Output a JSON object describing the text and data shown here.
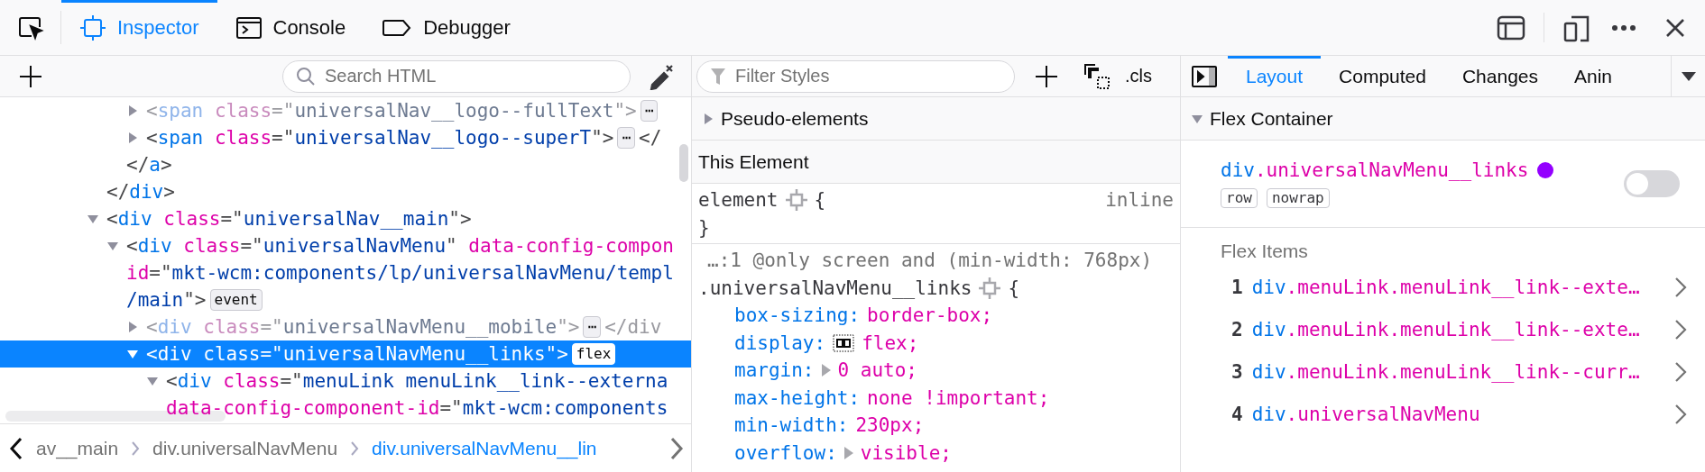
{
  "toolbar": {
    "tabs": [
      {
        "label": "Inspector",
        "kind": "inspector",
        "selected": true
      },
      {
        "label": "Console",
        "kind": "console",
        "selected": false
      },
      {
        "label": "Debugger",
        "kind": "debugger",
        "selected": false
      }
    ]
  },
  "markup": {
    "search_placeholder": "Search HTML",
    "nodes": [
      {
        "children": [
          {
            "children": [
              {
                "lines": [
                  [
                    {
                      "kind": "punct",
                      "text": "<"
                    },
                    {
                      "kind": "tag",
                      "text": "span"
                    },
                    {
                      "kind": "attr",
                      "text": " class"
                    },
                    {
                      "kind": "punct",
                      "text": "=\""
                    },
                    {
                      "kind": "value",
                      "text": "universalNav__logo--fullText"
                    },
                    {
                      "kind": "punct",
                      "text": "\">"
                    },
                    {
                      "kind": "badge",
                      "text": "⋯"
                    }
                  ]
                ],
                "expanded": false,
                "dimmed": true,
                "selected": false
              },
              {
                "lines": [
                  [
                    {
                      "kind": "punct",
                      "text": "<"
                    },
                    {
                      "kind": "tag",
                      "text": "span"
                    },
                    {
                      "kind": "attr",
                      "text": " class"
                    },
                    {
                      "kind": "punct",
                      "text": "=\""
                    },
                    {
                      "kind": "value",
                      "text": "universalNav__logo--superT"
                    },
                    {
                      "kind": "punct",
                      "text": "\">"
                    },
                    {
                      "kind": "badge",
                      "text": "⋯"
                    },
                    {
                      "kind": "punct",
                      "text": "</"
                    }
                  ]
                ],
                "expanded": false,
                "dimmed": false,
                "selected": false
              }
            ],
            "closing": [
              {
                "kind": "punct",
                "text": "</"
              },
              {
                "kind": "tag",
                "text": "a"
              },
              {
                "kind": "punct",
                "text": ">"
              }
            ]
          }
        ],
        "closing": [
          {
            "kind": "punct",
            "text": "</"
          },
          {
            "kind": "tag",
            "text": "div"
          },
          {
            "kind": "punct",
            "text": ">"
          }
        ]
      },
      {
        "lines": [
          [
            {
              "kind": "punct",
              "text": "<"
            },
            {
              "kind": "tag",
              "text": "div"
            },
            {
              "kind": "attr",
              "text": " class"
            },
            {
              "kind": "punct",
              "text": "=\""
            },
            {
              "kind": "value",
              "text": "universalNav__main"
            },
            {
              "kind": "punct",
              "text": "\">"
            }
          ]
        ],
        "expanded": true,
        "dimmed": false,
        "selected": false,
        "children": [
          {
            "lines": [
              [
                {
                  "kind": "punct",
                  "text": "<"
                },
                {
                  "kind": "tag",
                  "text": "div"
                },
                {
                  "kind": "attr",
                  "text": " class"
                },
                {
                  "kind": "punct",
                  "text": "=\""
                },
                {
                  "kind": "value",
                  "text": "universalNavMenu"
                },
                {
                  "kind": "punct",
                  "text": "\""
                },
                {
                  "kind": "attr",
                  "text": " data-config-compon"
                }
              ],
              [
                {
                  "kind": "attr",
                  "text": "id"
                },
                {
                  "kind": "punct",
                  "text": "=\""
                },
                {
                  "kind": "value",
                  "text": "mkt-wcm:components/lp/universalNavMenu/templ"
                }
              ],
              [
                {
                  "kind": "value",
                  "text": "/main"
                },
                {
                  "kind": "punct",
                  "text": "\">"
                },
                {
                  "kind": "badge",
                  "text": "event"
                }
              ]
            ],
            "expanded": true,
            "dimmed": false,
            "selected": false,
            "children": [
              {
                "lines": [
                  [
                    {
                      "kind": "punct",
                      "text": "<"
                    },
                    {
                      "kind": "tag",
                      "text": "div"
                    },
                    {
                      "kind": "attr",
                      "text": " class"
                    },
                    {
                      "kind": "punct",
                      "text": "=\""
                    },
                    {
                      "kind": "value",
                      "text": "universalNavMenu__mobile"
                    },
                    {
                      "kind": "punct",
                      "text": "\">"
                    },
                    {
                      "kind": "badge",
                      "text": "⋯"
                    },
                    {
                      "kind": "punct",
                      "text": "</div"
                    }
                  ]
                ],
                "expanded": false,
                "dimmed": true,
                "selected": false
              },
              {
                "lines": [
                  [
                    {
                      "kind": "punct",
                      "text": "<"
                    },
                    {
                      "kind": "tag",
                      "text": "div"
                    },
                    {
                      "kind": "attr",
                      "text": " class"
                    },
                    {
                      "kind": "punct",
                      "text": "=\""
                    },
                    {
                      "kind": "value",
                      "text": "universalNavMenu__links"
                    },
                    {
                      "kind": "punct",
                      "text": "\">"
                    },
                    {
                      "kind": "badge",
                      "text": "flex"
                    }
                  ]
                ],
                "expanded": true,
                "dimmed": false,
                "selected": true,
                "children": [
                  {
                    "lines": [
                      [
                        {
                          "kind": "punct",
                          "text": "<"
                        },
                        {
                          "kind": "tag",
                          "text": "div"
                        },
                        {
                          "kind": "attr",
                          "text": " class"
                        },
                        {
                          "kind": "punct",
                          "text": "=\""
                        },
                        {
                          "kind": "value",
                          "text": "menuLink menuLink__link--externa"
                        }
                      ],
                      [
                        {
                          "kind": "attr",
                          "text": "data-config-component-id"
                        },
                        {
                          "kind": "punct",
                          "text": "=\""
                        },
                        {
                          "kind": "value",
                          "text": "mkt-wcm:components"
                        }
                      ]
                    ],
                    "expanded": true,
                    "dimmed": false,
                    "selected": false
                  }
                ]
              }
            ]
          }
        ]
      }
    ],
    "breadcrumbs": [
      {
        "label": "av__main",
        "selected": false
      },
      {
        "label": "div.universalNavMenu",
        "selected": false
      },
      {
        "label": "div.universalNavMenu__lin",
        "selected": true
      }
    ]
  },
  "rules": {
    "filter_placeholder": "Filter Styles",
    "cls_label": ".cls",
    "pseudo": {
      "label": "Pseudo-elements",
      "expanded": false
    },
    "this_element": {
      "label": "This Element"
    },
    "element_rule": {
      "selector": "element",
      "open": "{",
      "source": "inline",
      "close": "}"
    },
    "media_rule": {
      "source": "…:1 @only screen and (min-width: 768px)",
      "selector": ".universalNavMenu__links",
      "open": "{",
      "declarations": [
        {
          "name": "box-sizing:",
          "value": "border-box;",
          "kind": "plain"
        },
        {
          "name": "display:",
          "value": "flex;",
          "kind": "flex"
        },
        {
          "name": "margin:",
          "value": "0 auto;",
          "kind": "expandable"
        },
        {
          "name": "max-height:",
          "value": "none !important;",
          "kind": "plain"
        },
        {
          "name": "min-width:",
          "value": "230px;",
          "kind": "plain"
        },
        {
          "name": "overflow:",
          "value": "visible;",
          "kind": "expandable"
        }
      ]
    }
  },
  "layout": {
    "tabs": [
      {
        "label": "Layout",
        "selected": true
      },
      {
        "label": "Computed",
        "selected": false
      },
      {
        "label": "Changes",
        "selected": false
      },
      {
        "label": "Anin",
        "selected": false
      }
    ],
    "flex_container": {
      "label": "Flex Container",
      "expanded": true,
      "tag": "div",
      "cls": ".universalNavMenu__links",
      "color": "#9400ff",
      "pills": [
        "row",
        "nowrap"
      ],
      "highlighter": {
        "on": false
      }
    },
    "flex_items": {
      "label": "Flex Items",
      "items": [
        {
          "index": "1",
          "tag": "div",
          "cls": ".menuLink.menuLink__link--exte…"
        },
        {
          "index": "2",
          "tag": "div",
          "cls": ".menuLink.menuLink__link--exte…"
        },
        {
          "index": "3",
          "tag": "div",
          "cls": ".menuLink.menuLink__link--curr…"
        },
        {
          "index": "4",
          "tag": "div",
          "cls": ".universalNavMenu"
        }
      ]
    }
  }
}
